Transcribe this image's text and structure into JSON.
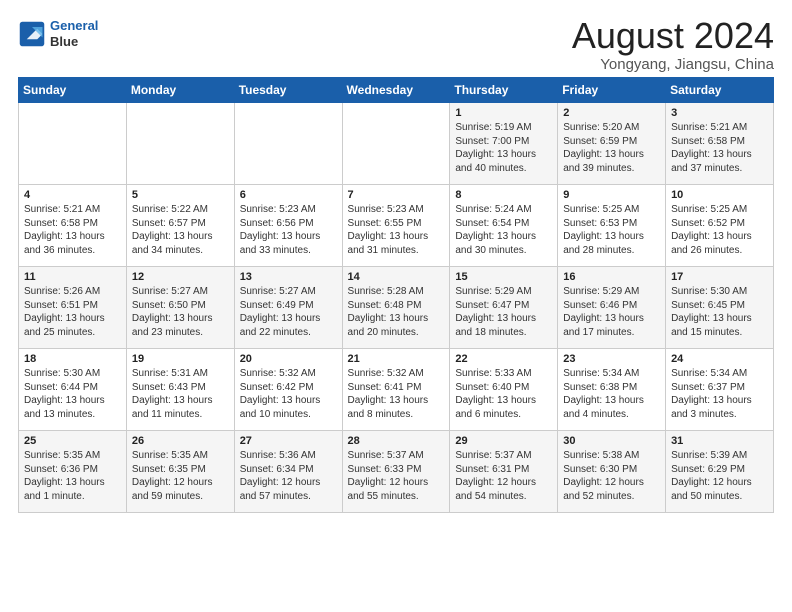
{
  "logo": {
    "line1": "General",
    "line2": "Blue"
  },
  "title": "August 2024",
  "subtitle": "Yongyang, Jiangsu, China",
  "days_of_week": [
    "Sunday",
    "Monday",
    "Tuesday",
    "Wednesday",
    "Thursday",
    "Friday",
    "Saturday"
  ],
  "weeks": [
    [
      {
        "day": "",
        "text": ""
      },
      {
        "day": "",
        "text": ""
      },
      {
        "day": "",
        "text": ""
      },
      {
        "day": "",
        "text": ""
      },
      {
        "day": "1",
        "text": "Sunrise: 5:19 AM\nSunset: 7:00 PM\nDaylight: 13 hours\nand 40 minutes."
      },
      {
        "day": "2",
        "text": "Sunrise: 5:20 AM\nSunset: 6:59 PM\nDaylight: 13 hours\nand 39 minutes."
      },
      {
        "day": "3",
        "text": "Sunrise: 5:21 AM\nSunset: 6:58 PM\nDaylight: 13 hours\nand 37 minutes."
      }
    ],
    [
      {
        "day": "4",
        "text": "Sunrise: 5:21 AM\nSunset: 6:58 PM\nDaylight: 13 hours\nand 36 minutes."
      },
      {
        "day": "5",
        "text": "Sunrise: 5:22 AM\nSunset: 6:57 PM\nDaylight: 13 hours\nand 34 minutes."
      },
      {
        "day": "6",
        "text": "Sunrise: 5:23 AM\nSunset: 6:56 PM\nDaylight: 13 hours\nand 33 minutes."
      },
      {
        "day": "7",
        "text": "Sunrise: 5:23 AM\nSunset: 6:55 PM\nDaylight: 13 hours\nand 31 minutes."
      },
      {
        "day": "8",
        "text": "Sunrise: 5:24 AM\nSunset: 6:54 PM\nDaylight: 13 hours\nand 30 minutes."
      },
      {
        "day": "9",
        "text": "Sunrise: 5:25 AM\nSunset: 6:53 PM\nDaylight: 13 hours\nand 28 minutes."
      },
      {
        "day": "10",
        "text": "Sunrise: 5:25 AM\nSunset: 6:52 PM\nDaylight: 13 hours\nand 26 minutes."
      }
    ],
    [
      {
        "day": "11",
        "text": "Sunrise: 5:26 AM\nSunset: 6:51 PM\nDaylight: 13 hours\nand 25 minutes."
      },
      {
        "day": "12",
        "text": "Sunrise: 5:27 AM\nSunset: 6:50 PM\nDaylight: 13 hours\nand 23 minutes."
      },
      {
        "day": "13",
        "text": "Sunrise: 5:27 AM\nSunset: 6:49 PM\nDaylight: 13 hours\nand 22 minutes."
      },
      {
        "day": "14",
        "text": "Sunrise: 5:28 AM\nSunset: 6:48 PM\nDaylight: 13 hours\nand 20 minutes."
      },
      {
        "day": "15",
        "text": "Sunrise: 5:29 AM\nSunset: 6:47 PM\nDaylight: 13 hours\nand 18 minutes."
      },
      {
        "day": "16",
        "text": "Sunrise: 5:29 AM\nSunset: 6:46 PM\nDaylight: 13 hours\nand 17 minutes."
      },
      {
        "day": "17",
        "text": "Sunrise: 5:30 AM\nSunset: 6:45 PM\nDaylight: 13 hours\nand 15 minutes."
      }
    ],
    [
      {
        "day": "18",
        "text": "Sunrise: 5:30 AM\nSunset: 6:44 PM\nDaylight: 13 hours\nand 13 minutes."
      },
      {
        "day": "19",
        "text": "Sunrise: 5:31 AM\nSunset: 6:43 PM\nDaylight: 13 hours\nand 11 minutes."
      },
      {
        "day": "20",
        "text": "Sunrise: 5:32 AM\nSunset: 6:42 PM\nDaylight: 13 hours\nand 10 minutes."
      },
      {
        "day": "21",
        "text": "Sunrise: 5:32 AM\nSunset: 6:41 PM\nDaylight: 13 hours\nand 8 minutes."
      },
      {
        "day": "22",
        "text": "Sunrise: 5:33 AM\nSunset: 6:40 PM\nDaylight: 13 hours\nand 6 minutes."
      },
      {
        "day": "23",
        "text": "Sunrise: 5:34 AM\nSunset: 6:38 PM\nDaylight: 13 hours\nand 4 minutes."
      },
      {
        "day": "24",
        "text": "Sunrise: 5:34 AM\nSunset: 6:37 PM\nDaylight: 13 hours\nand 3 minutes."
      }
    ],
    [
      {
        "day": "25",
        "text": "Sunrise: 5:35 AM\nSunset: 6:36 PM\nDaylight: 13 hours\nand 1 minute."
      },
      {
        "day": "26",
        "text": "Sunrise: 5:35 AM\nSunset: 6:35 PM\nDaylight: 12 hours\nand 59 minutes."
      },
      {
        "day": "27",
        "text": "Sunrise: 5:36 AM\nSunset: 6:34 PM\nDaylight: 12 hours\nand 57 minutes."
      },
      {
        "day": "28",
        "text": "Sunrise: 5:37 AM\nSunset: 6:33 PM\nDaylight: 12 hours\nand 55 minutes."
      },
      {
        "day": "29",
        "text": "Sunrise: 5:37 AM\nSunset: 6:31 PM\nDaylight: 12 hours\nand 54 minutes."
      },
      {
        "day": "30",
        "text": "Sunrise: 5:38 AM\nSunset: 6:30 PM\nDaylight: 12 hours\nand 52 minutes."
      },
      {
        "day": "31",
        "text": "Sunrise: 5:39 AM\nSunset: 6:29 PM\nDaylight: 12 hours\nand 50 minutes."
      }
    ]
  ]
}
